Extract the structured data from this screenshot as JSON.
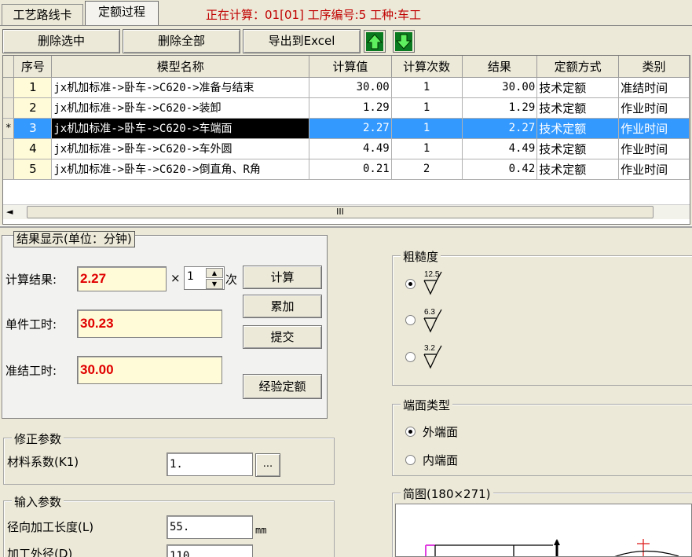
{
  "tabs": [
    {
      "label": "工艺路线卡"
    },
    {
      "label": "定额过程"
    }
  ],
  "status_text": "正在计算：01[01] 工序编号:5 工种:车工",
  "toolbar": {
    "delete_selected": "删除选中",
    "delete_all": "删除全部",
    "export_excel": "导出到Excel",
    "move_up_icon": "green-up-arrow-icon",
    "move_down_icon": "green-down-arrow-icon"
  },
  "table": {
    "columns": [
      "序号",
      "模型名称",
      "计算值",
      "计算次数",
      "结果",
      "定额方式",
      "类别"
    ],
    "rows": [
      {
        "indicator": "",
        "no": "1",
        "name": "jx机加标准->卧车->C620->准备与结束",
        "value": "30.00",
        "count": "1",
        "result": "30.00",
        "method": "技术定额",
        "category": "准结时间"
      },
      {
        "indicator": "",
        "no": "2",
        "name": "jx机加标准->卧车->C620->装卸",
        "value": "1.29",
        "count": "1",
        "result": "1.29",
        "method": "技术定额",
        "category": "作业时间"
      },
      {
        "indicator": "*",
        "no": "3",
        "name": "jx机加标准->卧车->C620->车端面",
        "value": "2.27",
        "count": "1",
        "result": "2.27",
        "method": "技术定额",
        "category": "作业时间"
      },
      {
        "indicator": "",
        "no": "4",
        "name": "jx机加标准->卧车->C620->车外圆",
        "value": "4.49",
        "count": "1",
        "result": "4.49",
        "method": "技术定额",
        "category": "作业时间"
      },
      {
        "indicator": "",
        "no": "5",
        "name": "jx机加标准->卧车->C620->倒直角、R角",
        "value": "0.21",
        "count": "2",
        "result": "0.42",
        "method": "技术定额",
        "category": "作业时间"
      }
    ],
    "scroll_thumb_label": "III"
  },
  "results": {
    "title": "结果显示(单位：分钟)",
    "calc_label": "计算结果:",
    "calc_value": "2.27",
    "times_prefix": "×",
    "times_value": "1",
    "times_suffix": "次",
    "unit_label": "单件工时:",
    "unit_value": "30.23",
    "prep_label": "准结工时:",
    "prep_value": "30.00",
    "btn_calculate": "计算",
    "btn_accumulate": "累加",
    "btn_submit": "提交",
    "btn_empirical": "经验定额"
  },
  "correction": {
    "title": "修正参数",
    "material_label": "材料系数(K1)",
    "material_value": "1.",
    "browse": "..."
  },
  "inputs": {
    "title": "输入参数",
    "radial_label": "径向加工长度(L)",
    "radial_value": "55.",
    "radial_unit": "mm",
    "outer_label": "加工外径(D)",
    "outer_value": "110"
  },
  "roughness": {
    "title": "粗糙度",
    "options": [
      {
        "value": "12.5",
        "selected": true
      },
      {
        "value": "6.3",
        "selected": false
      },
      {
        "value": "3.2",
        "selected": false
      }
    ]
  },
  "face_type": {
    "title": "端面类型",
    "options": [
      {
        "label": "外端面",
        "selected": true
      },
      {
        "label": "内端面",
        "selected": false
      }
    ]
  },
  "sketch": {
    "title": "简图(180×271)"
  }
}
